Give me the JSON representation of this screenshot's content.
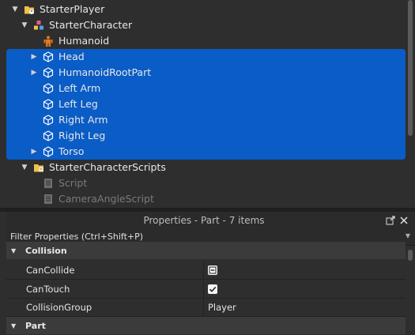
{
  "explorer": {
    "items": [
      {
        "label": "StarterPlayer",
        "icon": "starter-player-icon",
        "arrow": "▼",
        "indent": 0
      },
      {
        "label": "StarterCharacter",
        "icon": "model-icon",
        "arrow": "▼",
        "indent": 1
      },
      {
        "label": "Humanoid",
        "icon": "humanoid-icon",
        "arrow": "",
        "indent": 2
      },
      {
        "label": "Head",
        "icon": "part-icon",
        "arrow": "▶",
        "indent": 2,
        "selected": true
      },
      {
        "label": "HumanoidRootPart",
        "icon": "part-icon",
        "arrow": "▶",
        "indent": 2,
        "selected": true
      },
      {
        "label": "Left Arm",
        "icon": "part-icon",
        "arrow": "",
        "indent": 2,
        "selected": true
      },
      {
        "label": "Left Leg",
        "icon": "part-icon",
        "arrow": "",
        "indent": 2,
        "selected": true
      },
      {
        "label": "Right Arm",
        "icon": "part-icon",
        "arrow": "",
        "indent": 2,
        "selected": true
      },
      {
        "label": "Right Leg",
        "icon": "part-icon",
        "arrow": "",
        "indent": 2,
        "selected": true
      },
      {
        "label": "Torso",
        "icon": "part-icon",
        "arrow": "▶",
        "indent": 2,
        "selected": true
      },
      {
        "label": "StarterCharacterScripts",
        "icon": "scripts-folder-icon",
        "arrow": "▼",
        "indent": 1
      },
      {
        "label": "Script",
        "icon": "script-icon",
        "arrow": "",
        "indent": 2,
        "dim": true
      },
      {
        "label": "CameraAngleScript",
        "icon": "script-icon",
        "arrow": "",
        "indent": 2,
        "dim": true
      }
    ]
  },
  "properties": {
    "title": "Properties - Part - 7 items",
    "filter_placeholder": "Filter Properties (Ctrl+Shift+P)",
    "sections": {
      "collision": "Collision",
      "part": "Part"
    },
    "rows": [
      {
        "name": "CanCollide",
        "value_type": "indeterminate"
      },
      {
        "name": "CanTouch",
        "value_type": "checked"
      },
      {
        "name": "CollisionGroup",
        "value": "Player"
      }
    ]
  },
  "colors": {
    "selection": "#0a5cc6",
    "background": "#2e2e2e",
    "folder": "#f0c04a",
    "humanoid": "#e07a1a"
  }
}
